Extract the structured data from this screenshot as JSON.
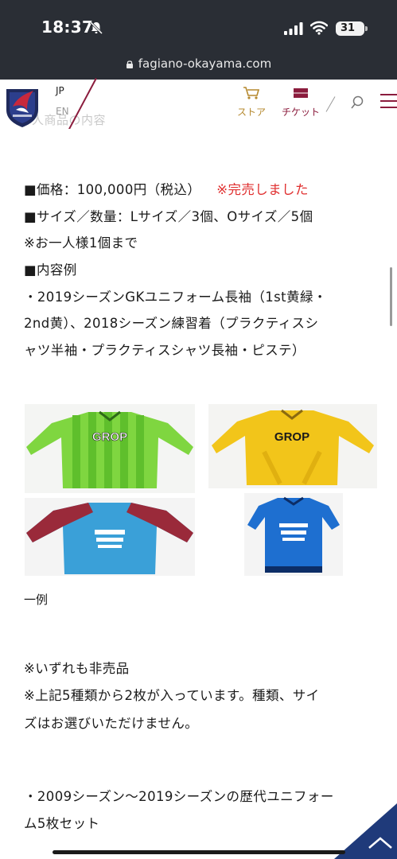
{
  "status": {
    "time": "18:37",
    "battery": "31"
  },
  "browser": {
    "url": "fagiano-okayama.com"
  },
  "header": {
    "lang_jp": "JP",
    "lang_en": "EN",
    "ghost_text": "人商品の内容",
    "store_label": "ストア",
    "ticket_label": "チケット",
    "colors": {
      "maroon": "#8b1c3d",
      "gold": "#b5892e"
    }
  },
  "product": {
    "price_line": "■価格：100,000円（税込）",
    "sold_out": "※完売しました",
    "size_line": "■サイズ／数量：Lサイズ／3個、Oサイズ／5個",
    "limit_line": "※お一人様1個まで",
    "contents_heading": "■内容例",
    "contents_line_1": "・2019シーズンGKユニフォーム長袖（1st黄緑・",
    "contents_line_2": "2nd黄）、2018シーズン練習着（プラクティスシ",
    "contents_line_3": "ャツ半袖・プラクティスシャツ長袖・ピステ）",
    "sponsor_text": "GROP",
    "caption": "一例",
    "note_1": "※いずれも非売品",
    "note_2": "※上記5種類から2枚が入っています。種類、サイ",
    "note_3": "ズはお選びいただけません。",
    "set_line_1": "・2009シーズン～2019シーズンの歴代ユニフォー",
    "set_line_2": "ム5枚セット",
    "sold_color": "#e03030"
  }
}
